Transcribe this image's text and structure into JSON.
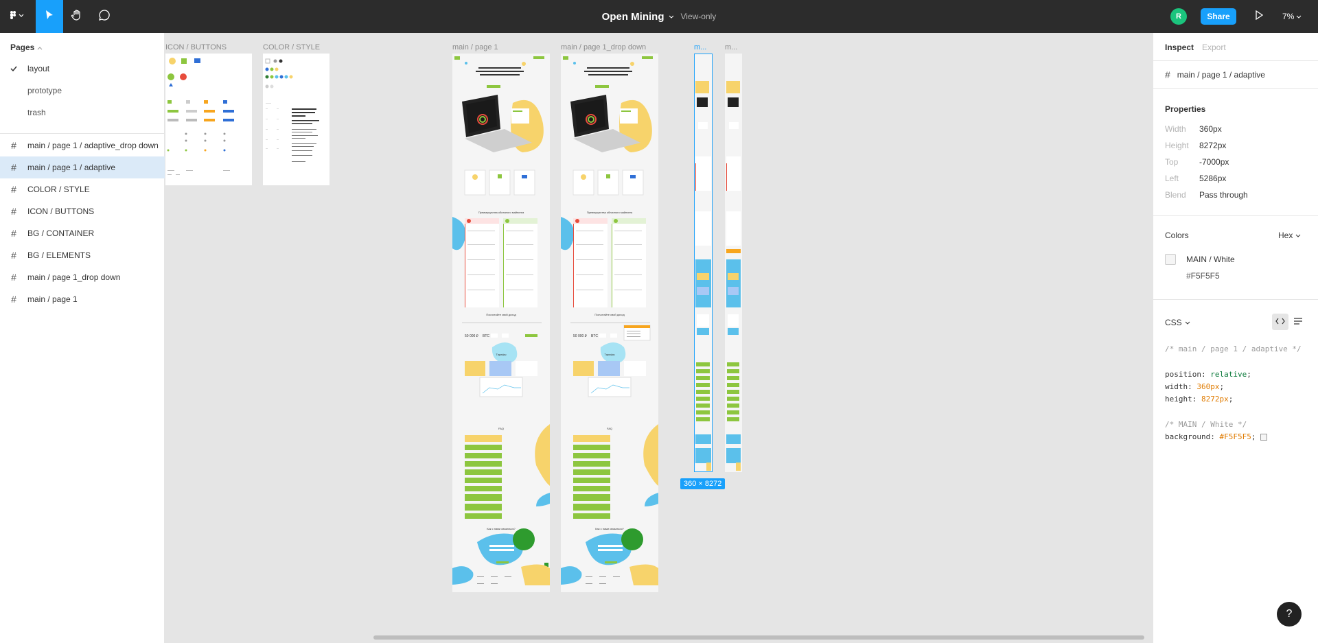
{
  "topbar": {
    "title": "Open Mining",
    "view_only": "View-only",
    "avatar_initial": "R",
    "share_label": "Share",
    "zoom": "7%",
    "icons": [
      "figma-menu-icon",
      "move-tool-icon",
      "hand-tool-icon",
      "comment-tool-icon",
      "play-icon"
    ]
  },
  "left_panel": {
    "pages_title": "Pages",
    "pages": [
      {
        "label": "layout",
        "current": true
      },
      {
        "label": "prototype",
        "current": false
      },
      {
        "label": "trash",
        "current": false
      }
    ],
    "layers": [
      {
        "label": "main / page 1 / adaptive_drop down",
        "selected": false
      },
      {
        "label": "main / page 1 / adaptive",
        "selected": true
      },
      {
        "label": "COLOR / STYLE",
        "selected": false
      },
      {
        "label": "ICON / BUTTONS",
        "selected": false
      },
      {
        "label": "BG / CONTAINER",
        "selected": false
      },
      {
        "label": "BG / ELEMENTS",
        "selected": false
      },
      {
        "label": "main / page 1_drop down",
        "selected": false
      },
      {
        "label": "main / page 1",
        "selected": false
      }
    ]
  },
  "canvas": {
    "frame_labels": {
      "icon_buttons": "ICON / BUTTONS",
      "color_style": "COLOR / STYLE",
      "main_page1": "main / page 1",
      "main_page1_drop": "main / page 1_drop down",
      "adaptive": "m...",
      "adaptive_drop": "m..."
    },
    "hero_title": "Снижение рисков связанных с майнингом по максимуму",
    "benefits_title": "Преимущества облачного майнинга",
    "calc_title": "Посчитайте свой доход",
    "calc_values": [
      "50 000 ₽",
      "BTC"
    ],
    "rates_title": "Тарифы",
    "faq_title": "FAQ",
    "contact_title": "Как с нами связаться?",
    "selected_size": "360 × 8272",
    "colors": {
      "green": "#8dc63f",
      "yellow": "#f7d36b",
      "blue": "#5bc0eb",
      "red": "#e74c3c",
      "navy": "#2f6fd6"
    }
  },
  "right_panel": {
    "tabs": {
      "inspect": "Inspect",
      "export": "Export"
    },
    "layer_name": "main / page 1 / adaptive",
    "properties_title": "Properties",
    "properties": [
      {
        "k": "Width",
        "v": "360px"
      },
      {
        "k": "Height",
        "v": "8272px"
      },
      {
        "k": "Top",
        "v": "-7000px"
      },
      {
        "k": "Left",
        "v": "5286px"
      },
      {
        "k": "Blend",
        "v": "Pass through"
      }
    ],
    "colors_title": "Colors",
    "color_format": "Hex",
    "color_name": "MAIN / White",
    "color_hex": "#F5F5F5",
    "css_title": "CSS",
    "css_comment1": "/* main / page 1 / adaptive */",
    "css_position_key": "position: ",
    "css_position_val": "relative",
    "css_width_key": "width: ",
    "css_width_val": "360px",
    "css_height_key": "height: ",
    "css_height_val": "8272px",
    "css_comment2": "/* MAIN / White */",
    "css_bg_key": "background: ",
    "css_bg_val": "#F5F5F5",
    "help": "?"
  }
}
